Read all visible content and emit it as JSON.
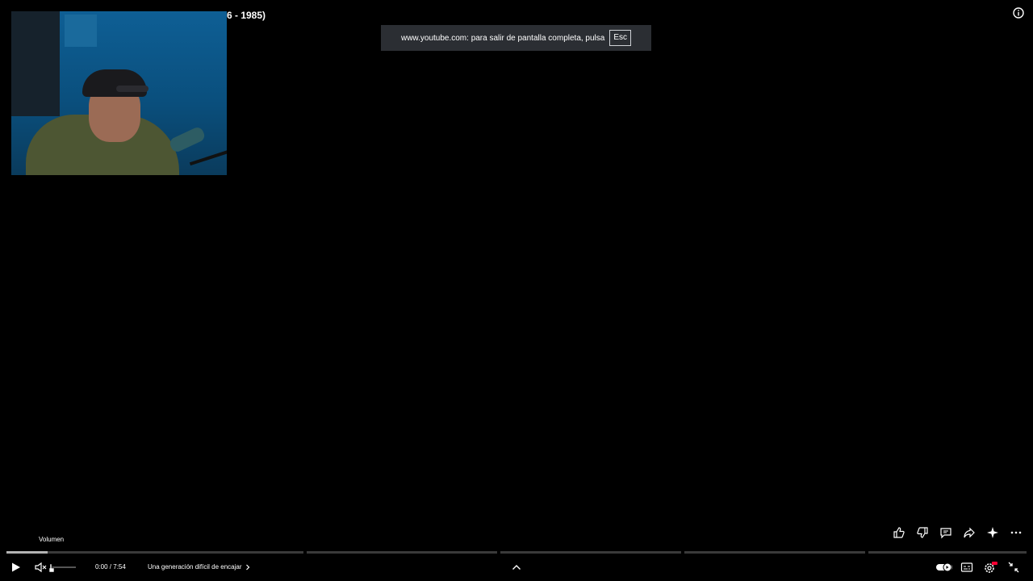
{
  "video": {
    "title_fragment": "6 - 1985)"
  },
  "fullscreen_banner": {
    "message": "www.youtube.com: para salir de pantalla completa, pulsa",
    "key": "Esc"
  },
  "tooltip": {
    "volume": "Volumen"
  },
  "controls": {
    "time": "0:00 / 7:54",
    "chapter": "Una generación difícil de encajar",
    "progress_fraction": 0.04,
    "volume_fraction": 0.0,
    "muted": true
  },
  "icons": {
    "info": "info-icon",
    "like": "thumbs-up-icon",
    "dislike": "thumbs-down-icon",
    "comments": "comment-icon",
    "share": "share-icon",
    "ask": "sparkle-icon",
    "more": "more-icon",
    "play": "play-icon",
    "volume": "volume-muted-icon",
    "chevron_up": "chevron-up-icon",
    "autoplay": "autoplay-toggle-icon",
    "subtitles": "subtitles-icon",
    "settings": "settings-icon",
    "exit_fullscreen": "exit-fullscreen-icon"
  },
  "colors": {
    "background": "#000000",
    "banner": "#2b2e33",
    "hd_badge": "#ff0033"
  }
}
